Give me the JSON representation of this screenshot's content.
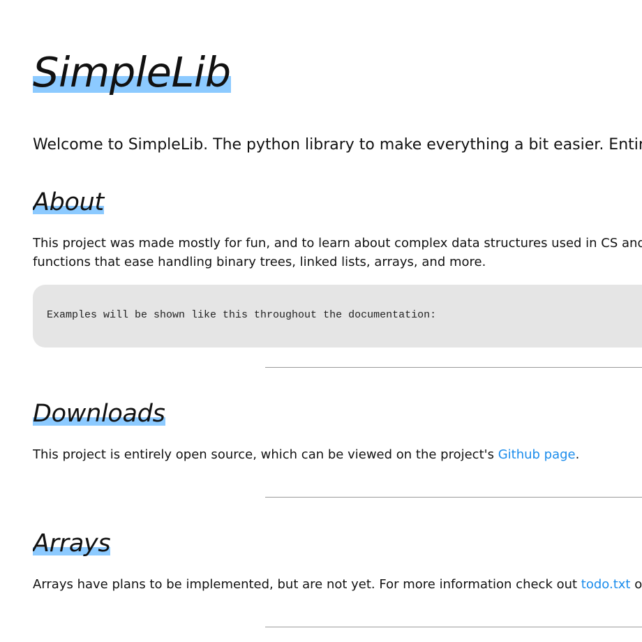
{
  "title": "SimpleLib",
  "intro": "Welcome to SimpleLib. The python library to make everything a bit easier. Entire",
  "about": {
    "heading": "About",
    "line1": "This project was made mostly for fun, and to learn about complex data structures used in CS and so",
    "line2": "functions that ease handling binary trees, linked lists, arrays, and more.",
    "code": "Examples will be shown like this throughout the documentation:"
  },
  "downloads": {
    "heading": "Downloads",
    "text_before": "This project is entirely open source, which can be viewed on the project's ",
    "link": "Github page",
    "text_after": "."
  },
  "arrays": {
    "heading": "Arrays",
    "text_before": "Arrays have plans to be implemented, but are not yet. For more information check out ",
    "link": "todo.txt",
    "text_after": " on th"
  },
  "colors": {
    "highlight": "#8ccaff",
    "link": "#1a8cec",
    "code_bg": "#e5e5e5",
    "rule": "#9a9a9a"
  }
}
